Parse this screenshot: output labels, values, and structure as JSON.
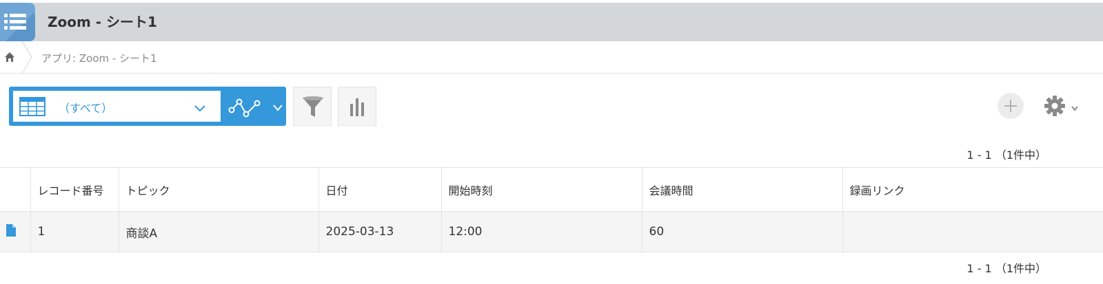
{
  "app": {
    "title": "Zoom - シート1",
    "icon": "list-icon"
  },
  "breadcrumb": {
    "home_icon": "home-icon",
    "path_text": "アプリ: Zoom - シート1"
  },
  "toolbar": {
    "view_icon": "table-view-icon",
    "view_selected": "（すべて）",
    "graph_icon": "line-graph-icon",
    "filter_icon": "filter-icon",
    "chart_icon": "bar-chart-icon",
    "add_icon": "plus-icon",
    "settings_icon": "gear-icon",
    "accent_color": "#3498db"
  },
  "pager": {
    "top": "1 - 1 （1件中）",
    "bottom": "1 - 1 （1件中）"
  },
  "table": {
    "columns": [
      "レコード番号",
      "トピック",
      "日付",
      "開始時刻",
      "会議時間",
      "録画リンク"
    ],
    "rows": [
      {
        "detail_icon": "document-icon",
        "cells": [
          "1",
          "商談A",
          "2025-03-13",
          "12:00",
          "60",
          ""
        ]
      }
    ]
  }
}
